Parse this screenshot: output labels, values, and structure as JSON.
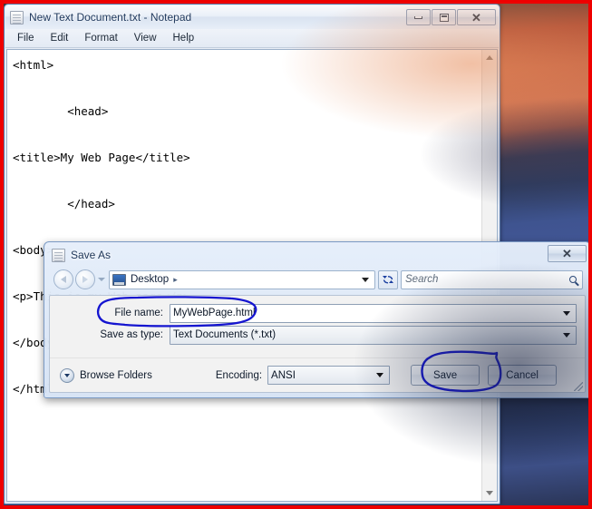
{
  "notepad": {
    "title": "New Text Document.txt - Notepad",
    "icon": "notepad-icon",
    "menu": [
      "File",
      "Edit",
      "Format",
      "View",
      "Help"
    ],
    "controls": {
      "minimize": "minimize-icon",
      "maximize": "maximize-icon",
      "close": "close-icon"
    },
    "document_text": "<html>\n\n        <head>\n\n<title>My Web Page</title>\n\n        </head>\n\n<body>\n\n<p>This is my Web page</p>\n\n</body>\n\n</html>",
    "scrollbar": {
      "up": "scroll-up-icon",
      "down": "scroll-down-icon"
    }
  },
  "save_dialog": {
    "title": "Save As",
    "icon": "notepad-icon",
    "close_label": "X",
    "nav": {
      "back": "back-arrow-icon",
      "forward": "forward-arrow-icon",
      "history": "history-chevron-icon",
      "refresh": "refresh-icon"
    },
    "address": {
      "icon": "desktop-icon",
      "path": "Desktop",
      "separator": "▸"
    },
    "search": {
      "placeholder": "Search",
      "icon": "search-icon"
    },
    "fields": [
      {
        "label": "File name:",
        "value": "MyWebPage.html",
        "style": "white"
      },
      {
        "label": "Save as type:",
        "value": "Text Documents (*.txt)",
        "style": "grey"
      }
    ],
    "browse_folders": {
      "label": "Browse Folders",
      "icon": "chevron-down-icon"
    },
    "encoding": {
      "label": "Encoding:",
      "value": "ANSI"
    },
    "buttons": {
      "save": "Save",
      "cancel": "Cancel"
    }
  },
  "annotations": {
    "color": "#1515d0",
    "items": [
      {
        "name": "file-name-circle",
        "target": "File name: MyWebPage.html"
      },
      {
        "name": "save-button-circle",
        "target": "Save"
      }
    ]
  },
  "desktop": {
    "wallpaper": "blurred-photo-background",
    "border_color": "#ee0000"
  }
}
